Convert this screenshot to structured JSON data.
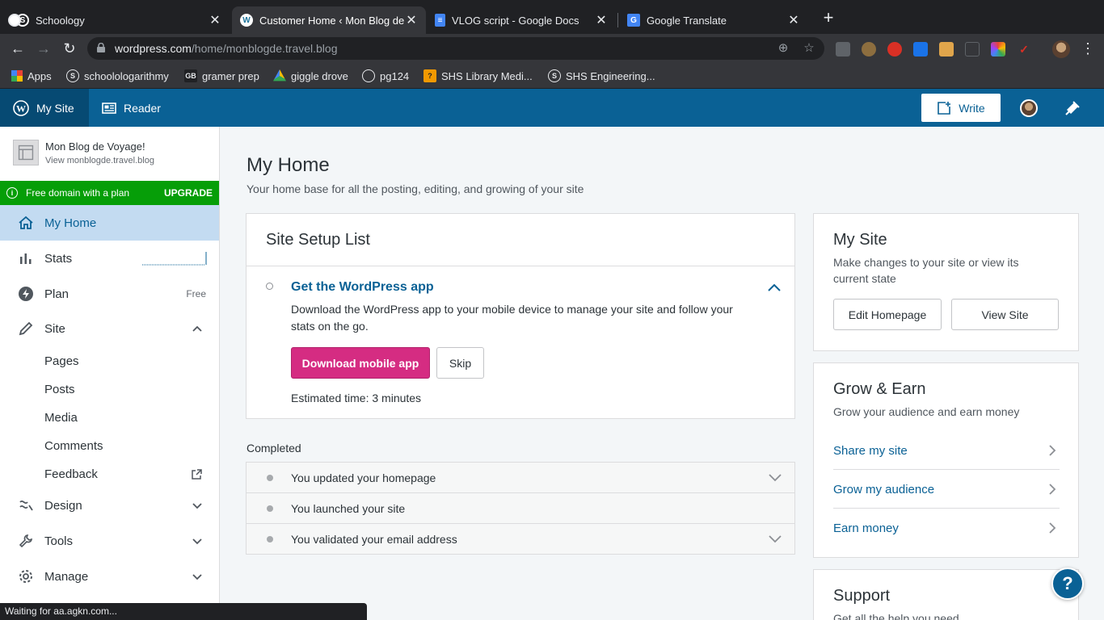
{
  "browser": {
    "tabs": [
      {
        "title": "Schoology",
        "close": "✕"
      },
      {
        "title": "Customer Home ‹ Mon Blog de",
        "close": "✕"
      },
      {
        "title": "VLOG script - Google Docs",
        "close": "✕"
      },
      {
        "title": "Google Translate",
        "close": "✕"
      }
    ],
    "new_tab": "+",
    "url_host": "wordpress.com",
    "url_path": "/home/monblogde.travel.blog",
    "bookmarks": [
      {
        "label": "Apps"
      },
      {
        "label": "schoolologarithmy"
      },
      {
        "label": "gramer prep"
      },
      {
        "label": "giggle drove"
      },
      {
        "label": "pg124"
      },
      {
        "label": "SHS Library Medi..."
      },
      {
        "label": "SHS Engineering..."
      }
    ],
    "status": "Waiting for aa.agkn.com..."
  },
  "masterbar": {
    "my_site": "My Site",
    "reader": "Reader",
    "write": "Write"
  },
  "sidebar": {
    "site_title": "Mon Blog de Voyage!",
    "site_url": "View monblogde.travel.blog",
    "upgrade_text": "Free domain with a plan",
    "upgrade_cta": "UPGRADE",
    "items": {
      "home": "My Home",
      "stats": "Stats",
      "plan": "Plan",
      "plan_badge": "Free",
      "site": "Site",
      "design": "Design",
      "tools": "Tools",
      "manage": "Manage"
    },
    "site_sub": [
      "Pages",
      "Posts",
      "Media",
      "Comments",
      "Feedback"
    ]
  },
  "main": {
    "title": "My Home",
    "subtitle": "Your home base for all the posting, editing, and growing of your site",
    "setup": {
      "header": "Site Setup List",
      "task_title": "Get the WordPress app",
      "task_desc": "Download the WordPress app to your mobile device to manage your site and follow your stats on the go.",
      "primary_btn": "Download mobile app",
      "skip_btn": "Skip",
      "estimate": "Estimated time: 3 minutes"
    },
    "completed_label": "Completed",
    "completed": [
      "You updated your homepage",
      "You launched your site",
      "You validated your email address"
    ]
  },
  "right": {
    "mysite": {
      "title": "My Site",
      "desc": "Make changes to your site or view its current state",
      "edit_btn": "Edit Homepage",
      "view_btn": "View Site"
    },
    "grow": {
      "title": "Grow & Earn",
      "desc": "Grow your audience and earn money",
      "links": [
        "Share my site",
        "Grow my audience",
        "Earn money"
      ]
    },
    "support": {
      "title": "Support",
      "desc": "Get all the help you need"
    },
    "help": "?"
  },
  "colors": {
    "masterbar": "#0a6195",
    "upgrade": "#069e08",
    "primary_btn": "#d52c82",
    "selected_nav": "#c3dbf1"
  }
}
